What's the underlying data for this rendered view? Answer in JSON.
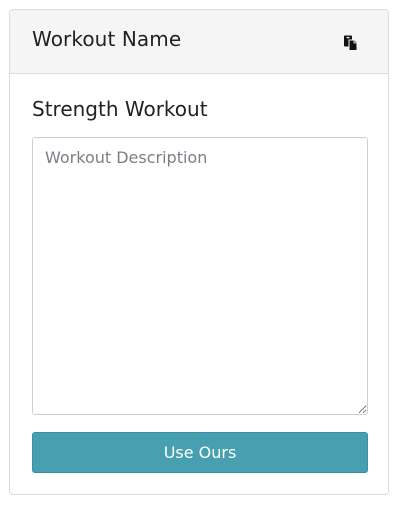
{
  "header": {
    "title": "Workout Name",
    "copy_icon": "copy-icon"
  },
  "workout": {
    "name": "Strength Workout"
  },
  "description": {
    "placeholder": "Workout Description",
    "value": ""
  },
  "actions": {
    "use_label": "Use Ours"
  },
  "colors": {
    "header_bg": "#f5f5f5",
    "button_bg": "#47a0b0",
    "button_text": "#ffffff",
    "border": "#dcdcdc"
  }
}
